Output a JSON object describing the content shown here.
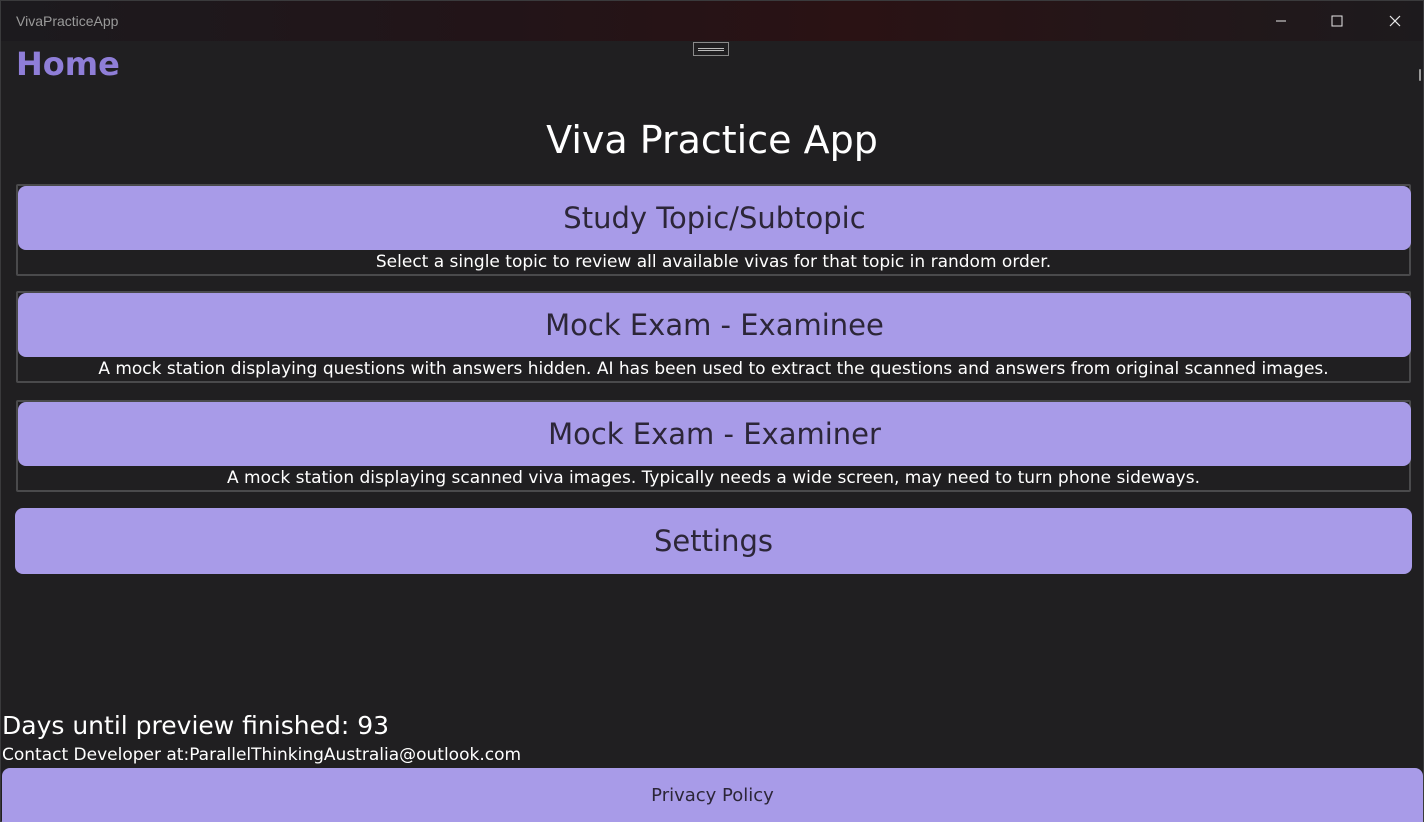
{
  "window": {
    "title": "VivaPracticeApp",
    "controls": {
      "minimize": "minimize-icon",
      "maximize": "maximize-icon",
      "close": "close-icon"
    }
  },
  "page": {
    "title": "Home",
    "heading": "Viva Practice App"
  },
  "menu": {
    "study": {
      "label": "Study Topic/Subtopic",
      "description": "Select a single topic to review all available vivas for that topic in random order."
    },
    "examinee": {
      "label": "Mock Exam - Examinee",
      "description": "A mock station displaying questions with answers hidden. AI has been used to extract the questions and answers from original scanned images."
    },
    "examiner": {
      "label": "Mock Exam - Examiner",
      "description": "A mock station displaying scanned viva images. Typically needs a wide screen, may need to turn phone sideways."
    },
    "settings": {
      "label": "Settings"
    }
  },
  "footer": {
    "days_remaining": "Days until preview finished: 93",
    "contact": "Contact Developer at:ParallelThinkingAustralia@outlook.com",
    "privacy_label": "Privacy Policy"
  },
  "colors": {
    "accent": "#a89be8",
    "title_accent": "#8f7ed8",
    "background": "#201f21",
    "button_text": "#2c2638"
  }
}
